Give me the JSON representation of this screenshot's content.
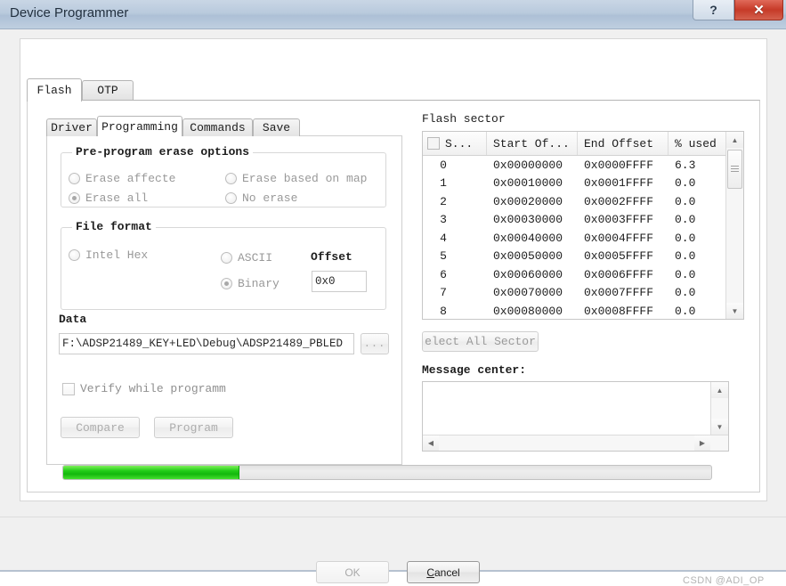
{
  "window": {
    "title": "Device Programmer",
    "help_button": "?",
    "close_button": "✕"
  },
  "outer_tabs": [
    {
      "label": "Flash",
      "active": true
    },
    {
      "label": "OTP",
      "active": false
    }
  ],
  "inner_tabs": [
    {
      "label": "Driver",
      "active": false
    },
    {
      "label": "Programming",
      "active": true
    },
    {
      "label": "Commands",
      "active": false
    },
    {
      "label": "Save",
      "active": false
    }
  ],
  "erase_group": {
    "legend": "Pre-program erase options",
    "options": [
      {
        "label": "Erase affecte",
        "checked": false
      },
      {
        "label": "Erase based on map",
        "checked": false
      },
      {
        "label": "Erase all",
        "checked": true
      },
      {
        "label": "No erase",
        "checked": false
      }
    ]
  },
  "file_format_group": {
    "legend": "File format",
    "options": [
      {
        "label": "Intel Hex",
        "checked": false
      },
      {
        "label": "ASCII",
        "checked": false
      },
      {
        "label": "Binary",
        "checked": true
      }
    ],
    "offset_label": "Offset",
    "offset_value": "0x0"
  },
  "data_section": {
    "label": "Data",
    "path_value": "F:\\ADSP21489_KEY+LED\\Debug\\ADSP21489_PBLED",
    "browse_label": "...",
    "verify_label": "Verify while programm",
    "verify_checked": false,
    "compare_label": "Compare",
    "program_label": "Program"
  },
  "flash_sector": {
    "title": "Flash sector",
    "columns": [
      "S...",
      "Start Of...",
      "End Offset",
      "% used"
    ],
    "header_checkbox_checked": false,
    "rows": [
      {
        "sector": "0",
        "start": "0x00000000",
        "end": "0x0000FFFF",
        "used": "6.3"
      },
      {
        "sector": "1",
        "start": "0x00010000",
        "end": "0x0001FFFF",
        "used": "0.0"
      },
      {
        "sector": "2",
        "start": "0x00020000",
        "end": "0x0002FFFF",
        "used": "0.0"
      },
      {
        "sector": "3",
        "start": "0x00030000",
        "end": "0x0003FFFF",
        "used": "0.0"
      },
      {
        "sector": "4",
        "start": "0x00040000",
        "end": "0x0004FFFF",
        "used": "0.0"
      },
      {
        "sector": "5",
        "start": "0x00050000",
        "end": "0x0005FFFF",
        "used": "0.0"
      },
      {
        "sector": "6",
        "start": "0x00060000",
        "end": "0x0006FFFF",
        "used": "0.0"
      },
      {
        "sector": "7",
        "start": "0x00070000",
        "end": "0x0007FFFF",
        "used": "0.0"
      },
      {
        "sector": "8",
        "start": "0x00080000",
        "end": "0x0008FFFF",
        "used": "0.0"
      }
    ],
    "select_all_label": "elect All Sector"
  },
  "message_center": {
    "title": "Message center:",
    "content": ""
  },
  "progress": {
    "percent": 27,
    "fill_color": "#22cc17"
  },
  "footer": {
    "ok_label": "OK",
    "cancel_label_prefix": "",
    "cancel_mnemonic": "C",
    "cancel_label_suffix": "ancel"
  },
  "watermark": "CSDN @ADI_OP"
}
